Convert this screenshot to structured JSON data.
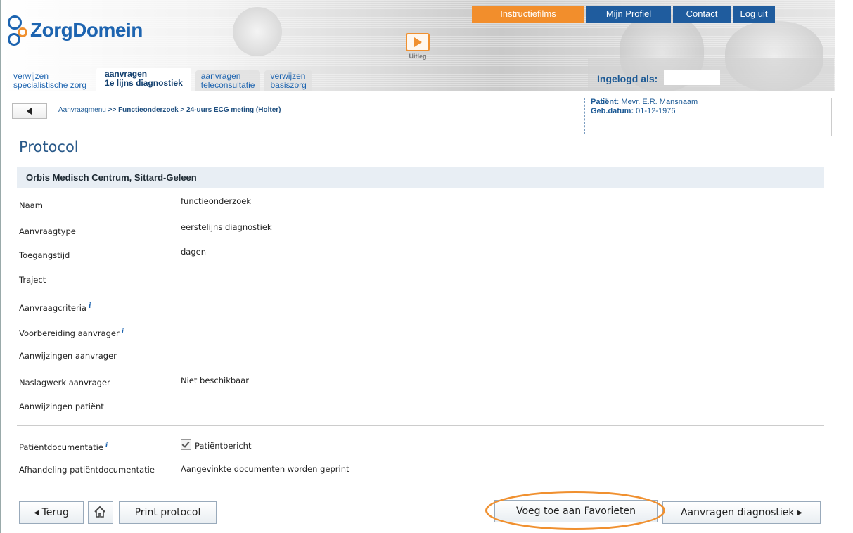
{
  "header": {
    "logo_text": "ZorgDomein",
    "uitleg_label": "Uitleg",
    "topnav": [
      "Instructiefilms",
      "Mijn Profiel",
      "Contact",
      "Log uit"
    ],
    "tabs": [
      {
        "line1": "verwijzen",
        "line2": "specialistische zorg"
      },
      {
        "line1": "aanvragen",
        "line2": "1e lijns diagnostiek"
      },
      {
        "line1": "aanvragen",
        "line2": "teleconsultatie"
      },
      {
        "line1": "verwijzen",
        "line2": "basiszorg"
      }
    ],
    "ingelogd_label": "Ingelogd als:"
  },
  "breadcrumb": {
    "link": "Aanvraagmenu",
    "rest": " >> Functieonderzoek > 24-uurs ECG meting (Holter)"
  },
  "patient": {
    "name_label": "Patiënt:",
    "name": " Mevr. E.R. Mansnaam",
    "dob_label": "Geb.datum:",
    "dob": " 01-12-1976"
  },
  "page_title": "Protocol",
  "org_name": "Orbis Medisch Centrum, Sittard-Geleen",
  "fields": [
    {
      "label": "Naam",
      "value": "functieonderzoek"
    },
    {
      "label": "Aanvraagtype",
      "value": "eerstelijns diagnostiek"
    },
    {
      "label": "Toegangstijd",
      "value": "dagen"
    },
    {
      "label": "Traject",
      "value": ""
    },
    {
      "label": "Aanvraagcriteria",
      "value": ""
    },
    {
      "label": "Voorbereiding aanvrager",
      "value": ""
    },
    {
      "label": "Aanwijzingen aanvrager",
      "value": ""
    },
    {
      "label": "Naslagwerk aanvrager",
      "value": "Niet beschikbaar"
    },
    {
      "label": "Aanwijzingen patiënt",
      "value": ""
    }
  ],
  "patientdoc": {
    "label": "Patiëntdocumentatie",
    "checkbox_label": "Patiëntbericht",
    "afhandeling_label": "Afhandeling patiëntdocumentatie",
    "afhandeling_value": "Aangevinkte documenten worden geprint"
  },
  "info_glyph": "i",
  "buttons": {
    "back": "◂ Terug",
    "print": "Print protocol",
    "favorite": "Voeg toe aan Favorieten",
    "next": "Aanvragen diagnostiek ▸"
  },
  "colors": {
    "accent_orange": "#f28e2c",
    "nav_blue": "#1f5c9e",
    "brand_blue": "#1d64b0"
  }
}
